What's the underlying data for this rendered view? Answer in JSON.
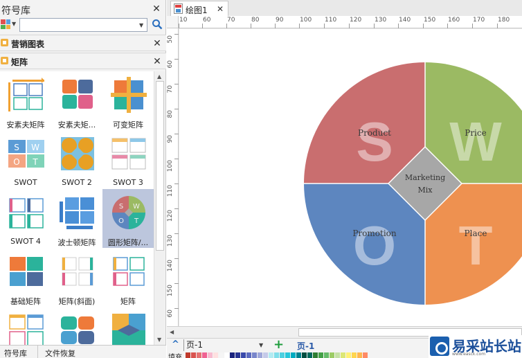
{
  "library": {
    "title": "符号库",
    "search_value": "",
    "categories": [
      {
        "label": "营销图表"
      },
      {
        "label": "矩阵"
      }
    ],
    "shapes": [
      {
        "label": "安素夫矩阵"
      },
      {
        "label": "安素夫矩..."
      },
      {
        "label": "可变矩阵"
      },
      {
        "label": "SWOT"
      },
      {
        "label": "SWOT 2"
      },
      {
        "label": "SWOT 3"
      },
      {
        "label": "SWOT 4"
      },
      {
        "label": "波士顿矩阵"
      },
      {
        "label": "圆形矩阵/..."
      },
      {
        "label": "基础矩阵"
      },
      {
        "label": "矩阵(斜面)"
      },
      {
        "label": "矩阵"
      },
      {
        "label": ""
      },
      {
        "label": ""
      },
      {
        "label": ""
      }
    ],
    "bottom_tabs": [
      "符号库",
      "文件恢复"
    ]
  },
  "thumb_letters": {
    "swot": [
      "S",
      "W",
      "O",
      "T"
    ]
  },
  "document": {
    "tab_label": "绘图1"
  },
  "rulers": {
    "horizontal": [
      "10",
      "60",
      "70",
      "80",
      "90",
      "100",
      "110",
      "120",
      "130",
      "140",
      "150",
      "160",
      "170",
      "180"
    ],
    "vertical": [
      "50",
      "60",
      "70",
      "80",
      "90",
      "100",
      "110",
      "120",
      "130",
      "140",
      "150",
      "60"
    ]
  },
  "diagram": {
    "big_letters": [
      "S",
      "W",
      "O",
      "T"
    ],
    "quadrant_labels": [
      "Product",
      "Price",
      "Promotion",
      "Place"
    ],
    "center_label_lines": [
      "Marketing",
      "Mix"
    ],
    "colors": {
      "s": "#c96e6f",
      "w": "#9bba63",
      "o": "#5d86bf",
      "t": "#ee9150",
      "center": "#a7a7a7"
    }
  },
  "page_bar": {
    "page_select": "页-1",
    "page_tab": "页-1"
  },
  "fill_bar": {
    "label": "填充",
    "swatches": [
      "#c0392b",
      "#d9534f",
      "#e57373",
      "#f06292",
      "#f8bbd0",
      "#ffe0e0",
      "#f5f5f5",
      "#ffffff",
      "#1a237e",
      "#283593",
      "#3949ab",
      "#5c6bc0",
      "#7986cb",
      "#9fa8da",
      "#c5cae9",
      "#b2ebf2",
      "#80deea",
      "#4dd0e1",
      "#26c6da",
      "#00acc1",
      "#00838f",
      "#004d40",
      "#00695c",
      "#2e7d32",
      "#43a047",
      "#66bb6a",
      "#9ccc65",
      "#c5e1a5",
      "#dce775",
      "#fff176",
      "#ffd54f",
      "#ffb74d",
      "#ff8a65"
    ]
  },
  "watermark": {
    "text": "易采站长站",
    "sub": "www.easck.com"
  }
}
